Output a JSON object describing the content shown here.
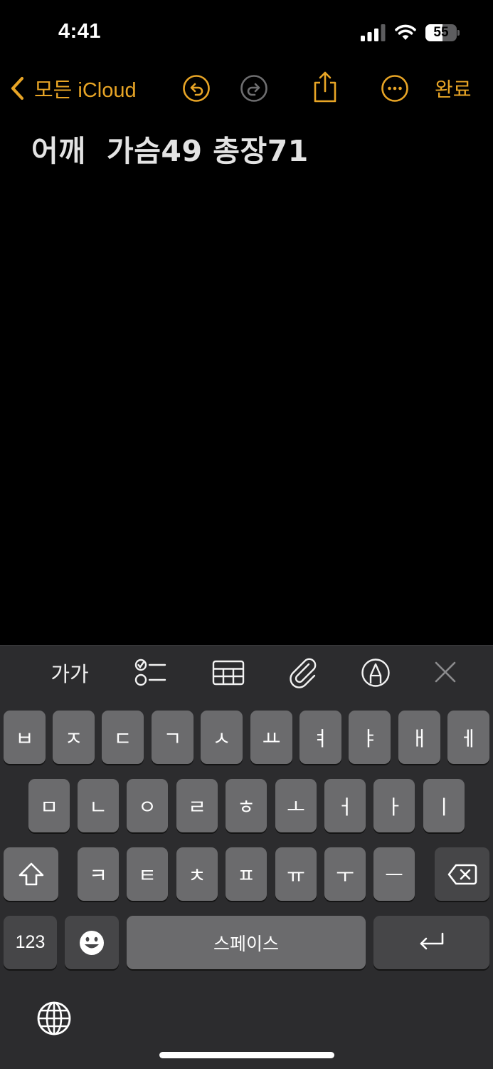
{
  "status_bar": {
    "time": "4:41",
    "battery_level": "55",
    "battery_fraction": 0.55,
    "icons": [
      "signal-icon",
      "wifi-icon",
      "battery-icon"
    ]
  },
  "nav": {
    "back_label": "모든 iCloud",
    "done_label": "완료",
    "accent_color": "#e8a526",
    "icons": [
      "chevron-left-icon",
      "undo-icon",
      "redo-icon",
      "share-icon",
      "more-icon"
    ]
  },
  "note": {
    "text": "어깨  가슴49 총장71"
  },
  "format_toolbar": {
    "text_style_label": "가가",
    "icons": [
      "checklist-icon",
      "table-icon",
      "paperclip-icon",
      "markup-pen-icon",
      "close-icon"
    ]
  },
  "keyboard": {
    "row1": [
      "ㅂ",
      "ㅈ",
      "ㄷ",
      "ㄱ",
      "ㅅ",
      "ㅛ",
      "ㅕ",
      "ㅑ",
      "ㅐ",
      "ㅔ"
    ],
    "row2": [
      "ㅁ",
      "ㄴ",
      "ㅇ",
      "ㄹ",
      "ㅎ",
      "ㅗ",
      "ㅓ",
      "ㅏ",
      "ㅣ"
    ],
    "row3": [
      "ㅋ",
      "ㅌ",
      "ㅊ",
      "ㅍ",
      "ㅠ",
      "ㅜ",
      "ㅡ"
    ],
    "numbers_label": "123",
    "space_label": "스페이스",
    "icons": [
      "shift-icon",
      "delete-icon",
      "emoji-icon",
      "return-icon",
      "globe-icon"
    ]
  }
}
